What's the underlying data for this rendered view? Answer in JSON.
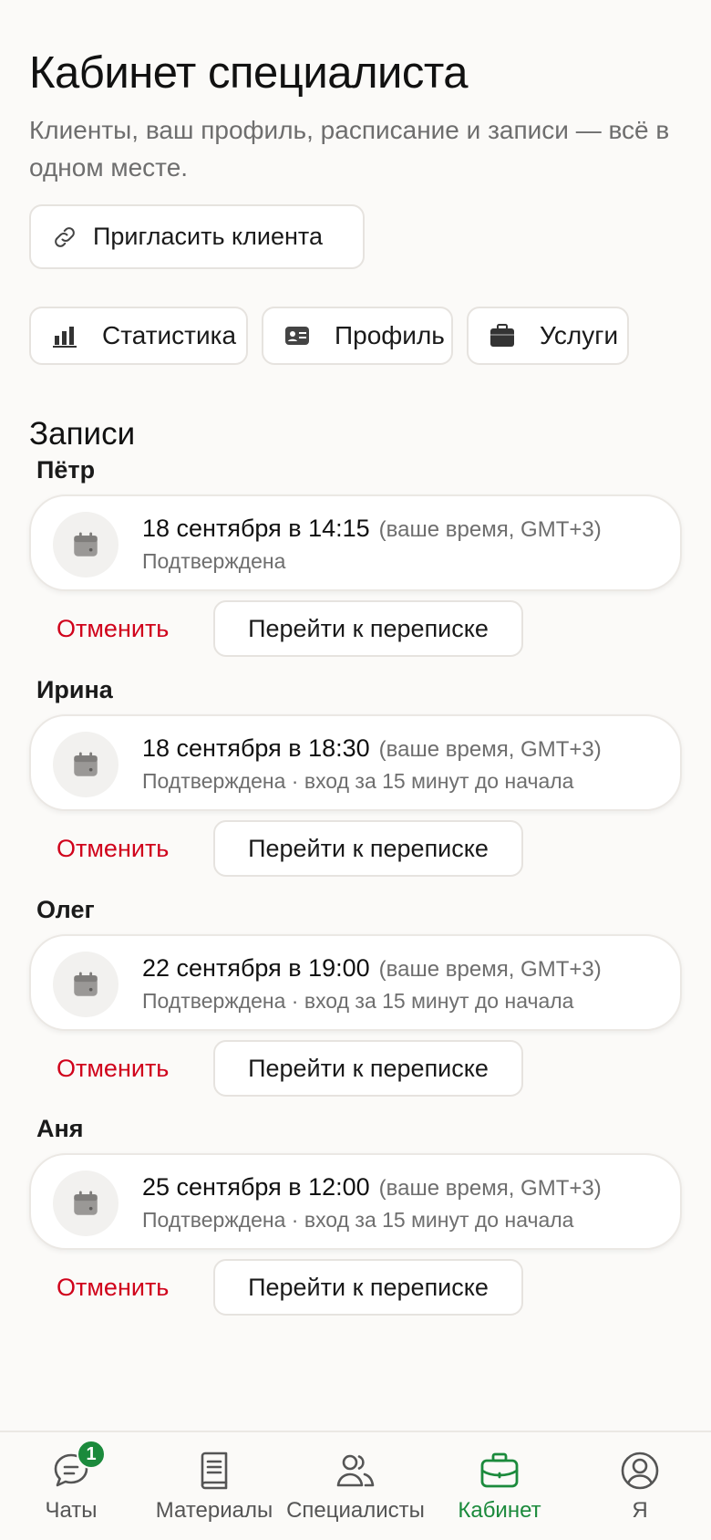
{
  "header": {
    "title": "Кабинет специалиста",
    "subtitle": "Клиенты, ваш профиль, расписание и записи — всё в одном месте."
  },
  "invite": {
    "label": "Пригласить клиента",
    "icon": "link-icon"
  },
  "quick_actions": [
    {
      "label": "Статистика",
      "icon": "bar-chart-icon"
    },
    {
      "label": "Профиль",
      "icon": "id-card-icon"
    },
    {
      "label": "Услуги",
      "icon": "briefcase-icon"
    }
  ],
  "bookings_section": {
    "title": "Записи"
  },
  "bookings": [
    {
      "client": "Пётр",
      "when": "18 сентября в 14:15",
      "tz": "(ваше время, GMT+3)",
      "status": "Подтверждена",
      "cancel": "Отменить",
      "chat": "Перейти к переписке"
    },
    {
      "client": "Ирина",
      "when": "18 сентября в 18:30",
      "tz": "(ваше время, GMT+3)",
      "status": "Подтверждена · вход за 15 минут до начала",
      "cancel": "Отменить",
      "chat": "Перейти к переписке"
    },
    {
      "client": "Олег",
      "when": "22 сентября в 19:00",
      "tz": "(ваше время, GMT+3)",
      "status": "Подтверждена · вход за 15 минут до начала",
      "cancel": "Отменить",
      "chat": "Перейти к переписке"
    },
    {
      "client": "Аня",
      "when": "25 сентября в 12:00",
      "tz": "(ваше время, GMT+3)",
      "status": "Подтверждена · вход за 15 минут до начала",
      "cancel": "Отменить",
      "chat": "Перейти к переписке"
    }
  ],
  "tabbar": {
    "items": [
      {
        "label": "Чаты",
        "icon": "chat-icon",
        "badge": "1"
      },
      {
        "label": "Материалы",
        "icon": "book-icon"
      },
      {
        "label": "Специалисты",
        "icon": "users-icon"
      },
      {
        "label": "Кабинет",
        "icon": "briefcase-icon",
        "active": true
      },
      {
        "label": "Я",
        "icon": "profile-icon"
      }
    ]
  },
  "colors": {
    "accent": "#1b8a3c",
    "danger": "#d0021b",
    "muted_text": "#6e6e6e",
    "background": "#fbfaf8"
  }
}
